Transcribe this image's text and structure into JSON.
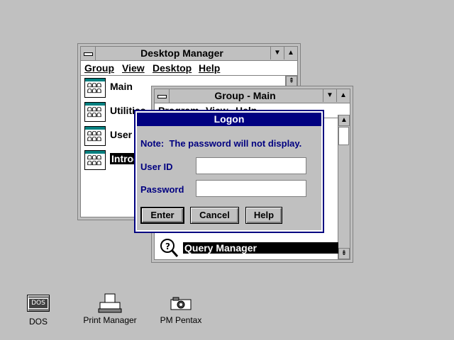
{
  "desktop_manager": {
    "title": "Desktop Manager",
    "menu": [
      "Group",
      "View",
      "Desktop",
      "Help"
    ],
    "items": [
      "Main",
      "Utilities",
      "User",
      "Introd"
    ]
  },
  "group_main": {
    "title": "Group - Main",
    "menu": [
      "Program",
      "View",
      "Help"
    ],
    "item": "Query Manager"
  },
  "logon": {
    "title": "Logon",
    "note": "Note:  The password will not display.",
    "user_id_label": "User ID",
    "password_label": "Password",
    "user_id_value": "",
    "password_value": "",
    "buttons": [
      "Enter",
      "Cancel",
      "Help"
    ]
  },
  "desktop_icons": [
    {
      "label": "DOS",
      "icon_text": "DOS",
      "icon": "dos-icon"
    },
    {
      "label": "Print Manager",
      "icon": "printer-icon"
    },
    {
      "label": "PM Pentax",
      "icon": "camera-icon"
    }
  ],
  "colors": {
    "desktop": "#c0c0c0",
    "active_title": "#000080",
    "selection": "#000000",
    "group_icon_band": "#008080"
  }
}
